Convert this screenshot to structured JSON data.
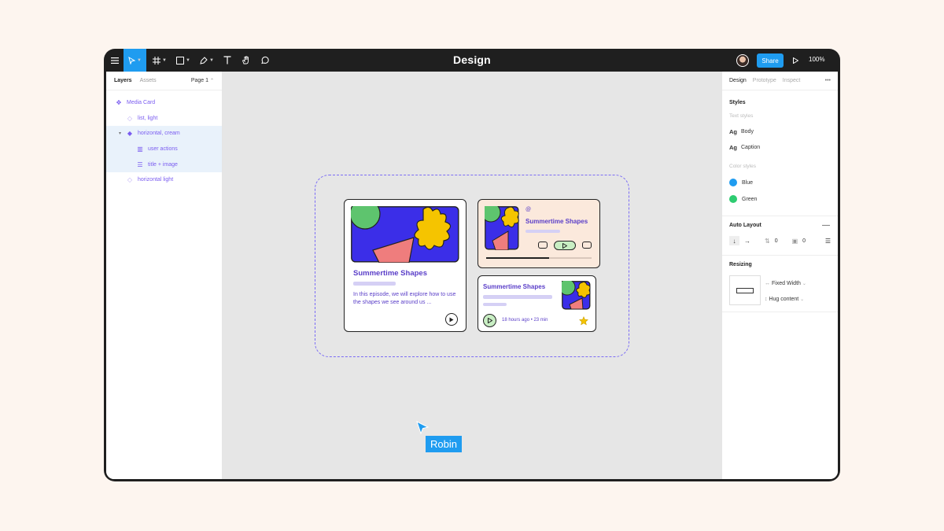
{
  "window": {
    "title": "Design",
    "zoom": "100%",
    "share_label": "Share"
  },
  "left_panel": {
    "tabs": [
      "Layers",
      "Assets"
    ],
    "page": "Page 1",
    "layers": [
      {
        "label": "Media Card",
        "icon": "component-icon"
      },
      {
        "label": "list, light",
        "icon": "instance-icon"
      },
      {
        "label": "horizontal, cream",
        "icon": "instance-icon"
      },
      {
        "label": "user actions",
        "icon": "frame-icon"
      },
      {
        "label": "title + image",
        "icon": "frame-icon"
      },
      {
        "label": "horizontal light",
        "icon": "instance-icon"
      }
    ]
  },
  "right_panel": {
    "tabs": [
      "Design",
      "Prototype",
      "Inspect"
    ],
    "styles": {
      "title": "Styles",
      "text_styles_label": "Text styles",
      "text_styles": [
        {
          "prefix": "Ag",
          "name": "Body"
        },
        {
          "prefix": "Ag",
          "name": "Caption"
        }
      ],
      "color_styles_label": "Color styles",
      "color_styles": [
        {
          "name": "Blue",
          "color": "#1f9cf0"
        },
        {
          "name": "Green",
          "color": "#2ecc71"
        }
      ]
    },
    "auto_layout": {
      "title": "Auto Layout",
      "spacing": "0",
      "padding": "0"
    },
    "resizing": {
      "title": "Resizing",
      "width": "Fixed Width",
      "height": "Hug content"
    }
  },
  "canvas": {
    "card_large": {
      "title": "Summertime Shapes",
      "description": "In this episode, we will explore how to use the shapes we see around us ..."
    },
    "card_cream": {
      "title": "Summertime Shapes"
    },
    "card_small": {
      "title": "Summertime Shapes",
      "meta": "18 hours ago • 23 min"
    },
    "cursor_label": "Robin"
  },
  "colors": {
    "accent_purple": "#5a3ec8",
    "share_blue": "#1f9cf0",
    "art_blue": "#3b2ee8",
    "art_green": "#5ec46e",
    "art_yellow": "#f5c400",
    "art_pink": "#ef7d7d",
    "cream": "#fbe9dc"
  }
}
